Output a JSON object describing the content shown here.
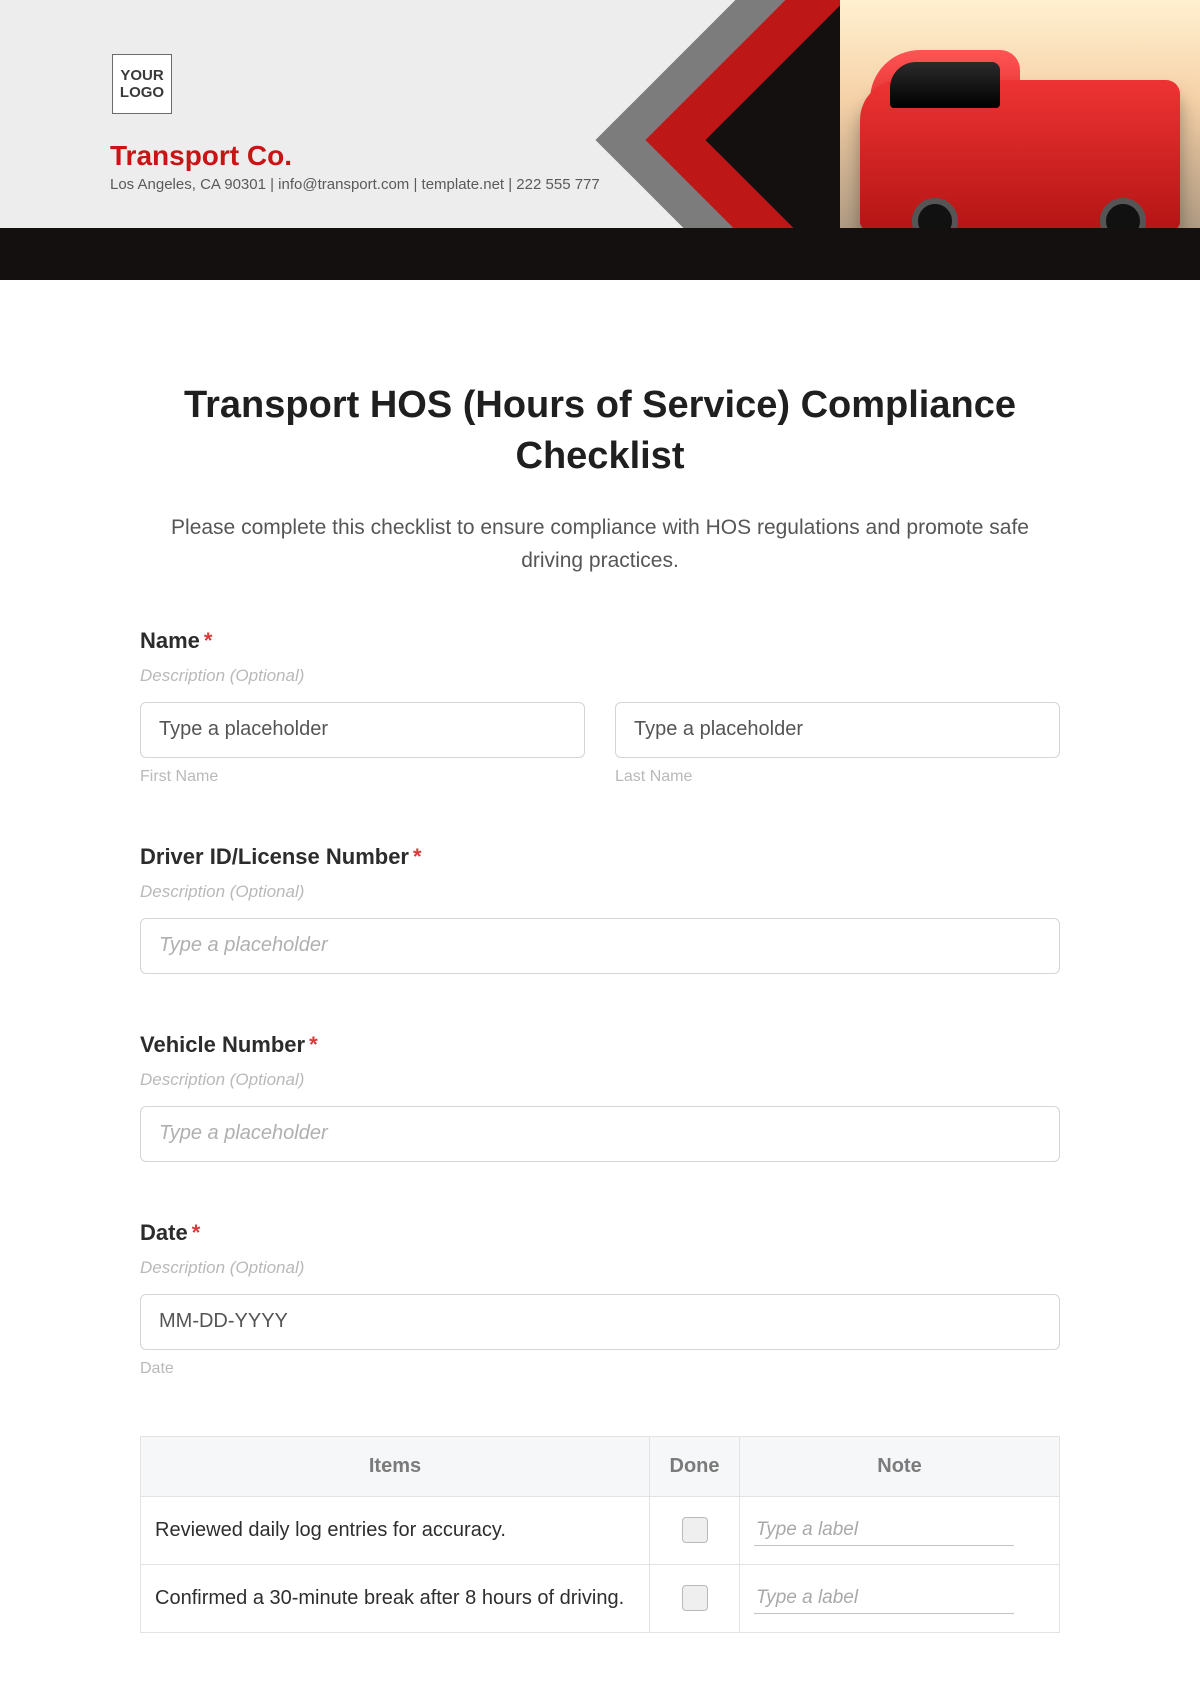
{
  "header": {
    "logo_text": "YOUR LOGO",
    "company_name": "Transport Co.",
    "contact_line": "Los Angeles, CA 90301 | info@transport.com | template.net | 222 555 777"
  },
  "form": {
    "title": "Transport HOS (Hours of Service) Compliance Checklist",
    "description": "Please complete this checklist to ensure compliance with HOS regulations and promote safe driving practices.",
    "required_mark": "*",
    "desc_optional": "Description (Optional)",
    "placeholder_text": "Type a placeholder",
    "name": {
      "label": "Name",
      "first_hint": "First Name",
      "last_hint": "Last Name"
    },
    "driver_id": {
      "label": "Driver ID/License Number"
    },
    "vehicle": {
      "label": "Vehicle Number"
    },
    "date": {
      "label": "Date",
      "placeholder": "MM-DD-YYYY",
      "hint": "Date"
    }
  },
  "table": {
    "columns": {
      "items": "Items",
      "done": "Done",
      "note": "Note"
    },
    "note_placeholder": "Type a label",
    "rows": [
      {
        "item": "Reviewed daily log entries for accuracy."
      },
      {
        "item": "Confirmed a 30-minute break after 8 hours of driving."
      }
    ]
  }
}
